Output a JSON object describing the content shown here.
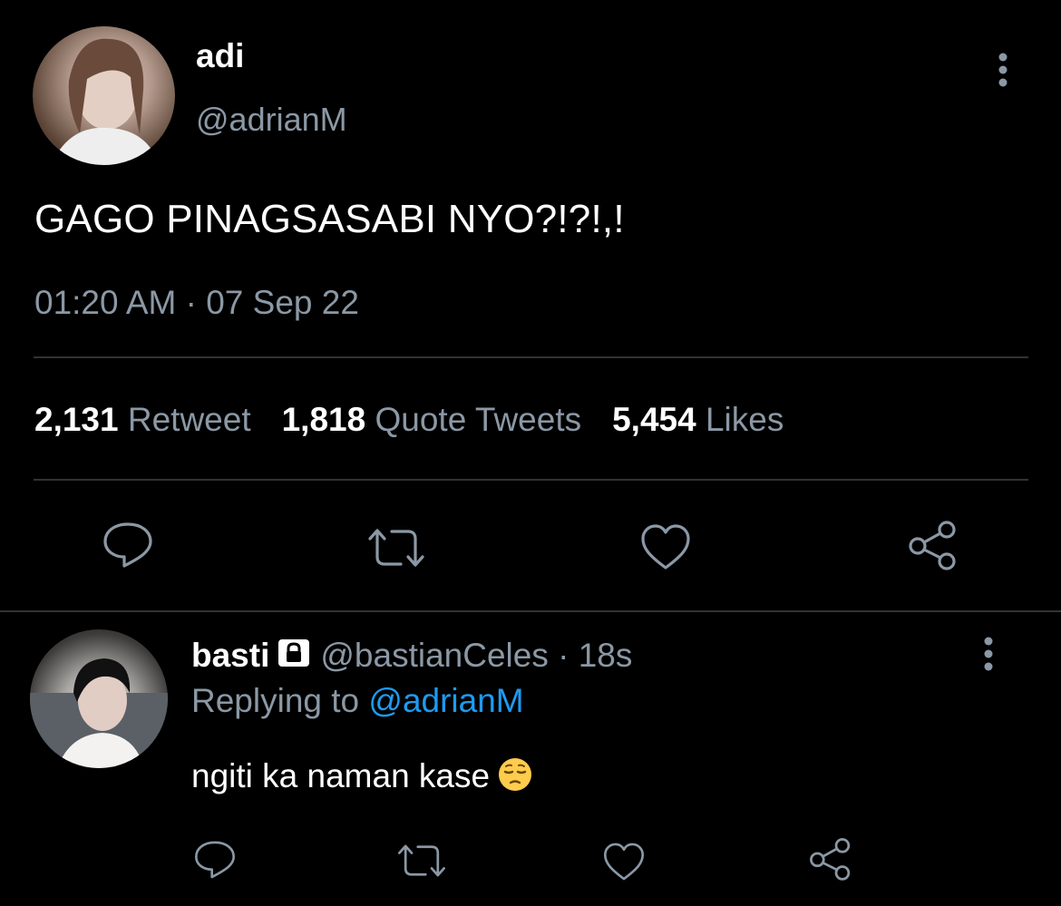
{
  "tweet": {
    "display_name": "adi",
    "handle": "@adrianM",
    "text": "GAGO PINAGSASABI NYO?!?!,!",
    "timestamp": "01:20 AM · 07 Sep 22",
    "stats": {
      "retweets_count": "2,131",
      "retweets_label": "Retweet",
      "quotes_count": "1,818",
      "quotes_label": "Quote Tweets",
      "likes_count": "5,454",
      "likes_label": "Likes"
    },
    "actions": [
      "reply-icon",
      "retweet-icon",
      "like-icon",
      "share-icon"
    ]
  },
  "reply": {
    "display_name": "basti",
    "handle_time": "@bastianCeles · 18s",
    "replying_prefix": "Replying to",
    "replying_mention": "@adrianM",
    "text": "ngiti ka naman kase",
    "emoji": "pensive-face-emoji",
    "actions": [
      "reply-icon",
      "retweet-icon",
      "like-icon",
      "share-icon"
    ]
  },
  "colors": {
    "background": "#000000",
    "text_primary": "#ffffff",
    "text_secondary": "#8b98a5",
    "link": "#1d9bf0",
    "divider": "#2f3336"
  }
}
